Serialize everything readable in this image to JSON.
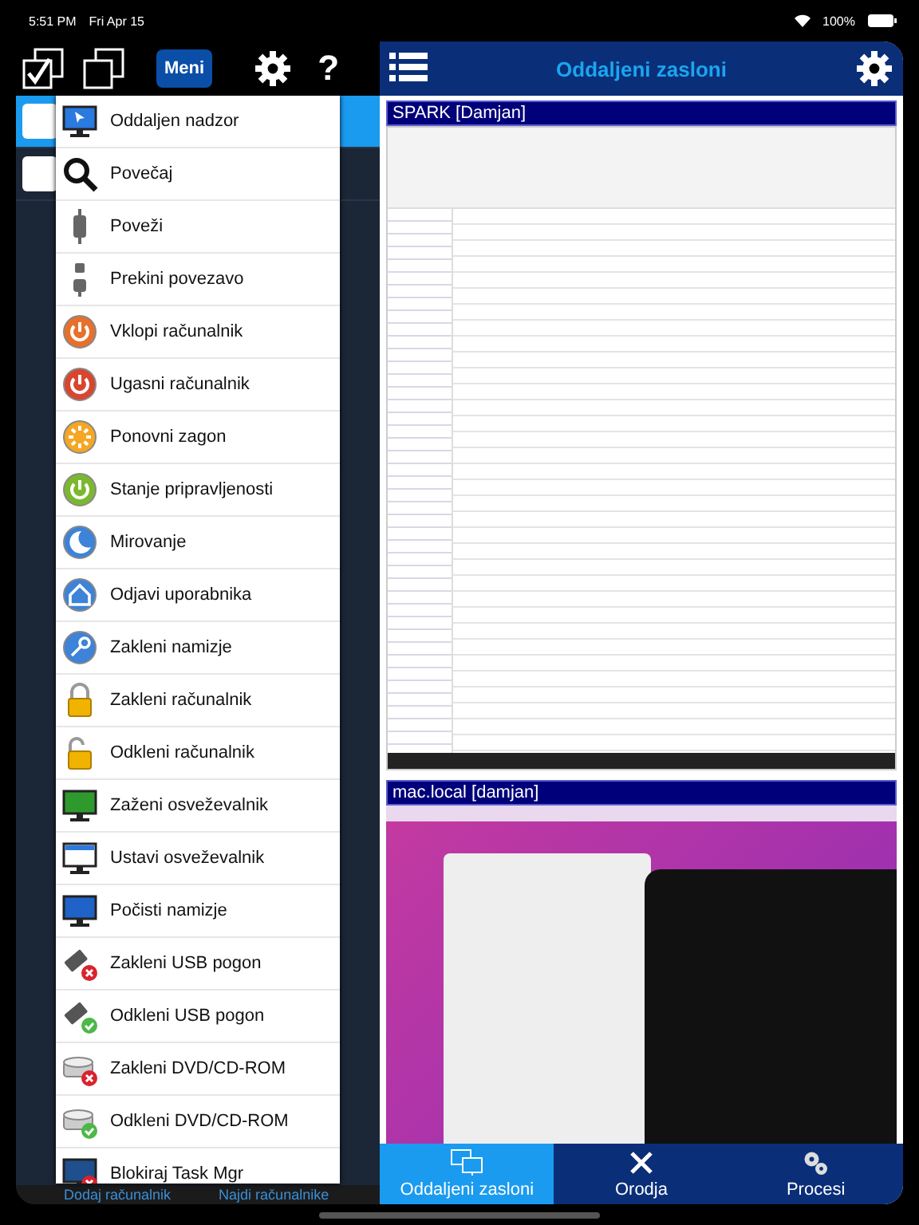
{
  "status_bar": {
    "time": "5:51 PM",
    "date": "Fri Apr 15",
    "battery": "100%"
  },
  "toolbar": {
    "menu_button": "Meni",
    "help": "?"
  },
  "computer_list": [
    {
      "selected": true
    },
    {
      "selected": false
    }
  ],
  "footer_links": [
    "Dodaj računalnik",
    "Najdi računalnike"
  ],
  "menu": {
    "items": [
      {
        "label": "Oddaljen nadzor"
      },
      {
        "label": "Povečaj"
      },
      {
        "label": "Poveži"
      },
      {
        "label": "Prekini povezavo"
      },
      {
        "label": "Vklopi računalnik"
      },
      {
        "label": "Ugasni računalnik"
      },
      {
        "label": "Ponovni zagon"
      },
      {
        "label": "Stanje pripravljenosti"
      },
      {
        "label": "Mirovanje"
      },
      {
        "label": "Odjavi uporabnika"
      },
      {
        "label": "Zakleni namizje"
      },
      {
        "label": "Zakleni računalnik"
      },
      {
        "label": "Odkleni računalnik"
      },
      {
        "label": "Zaženi osveževalnik"
      },
      {
        "label": "Ustavi osveževalnik"
      },
      {
        "label": "Počisti namizje"
      },
      {
        "label": "Zakleni USB pogon"
      },
      {
        "label": "Odkleni USB pogon"
      },
      {
        "label": "Zakleni DVD/CD-ROM"
      },
      {
        "label": "Odkleni DVD/CD-ROM"
      },
      {
        "label": "Blokiraj Task Mgr"
      }
    ]
  },
  "header": {
    "title": "Oddaljeni zasloni"
  },
  "screens": [
    {
      "kind": "windows",
      "caption": "SPARK [Damjan]"
    },
    {
      "kind": "mac",
      "caption": "mac.local [damjan]"
    }
  ],
  "tabs": [
    {
      "label": "Oddaljeni zasloni",
      "selected": true
    },
    {
      "label": "Orodja",
      "selected": false
    },
    {
      "label": "Procesi",
      "selected": false
    }
  ]
}
